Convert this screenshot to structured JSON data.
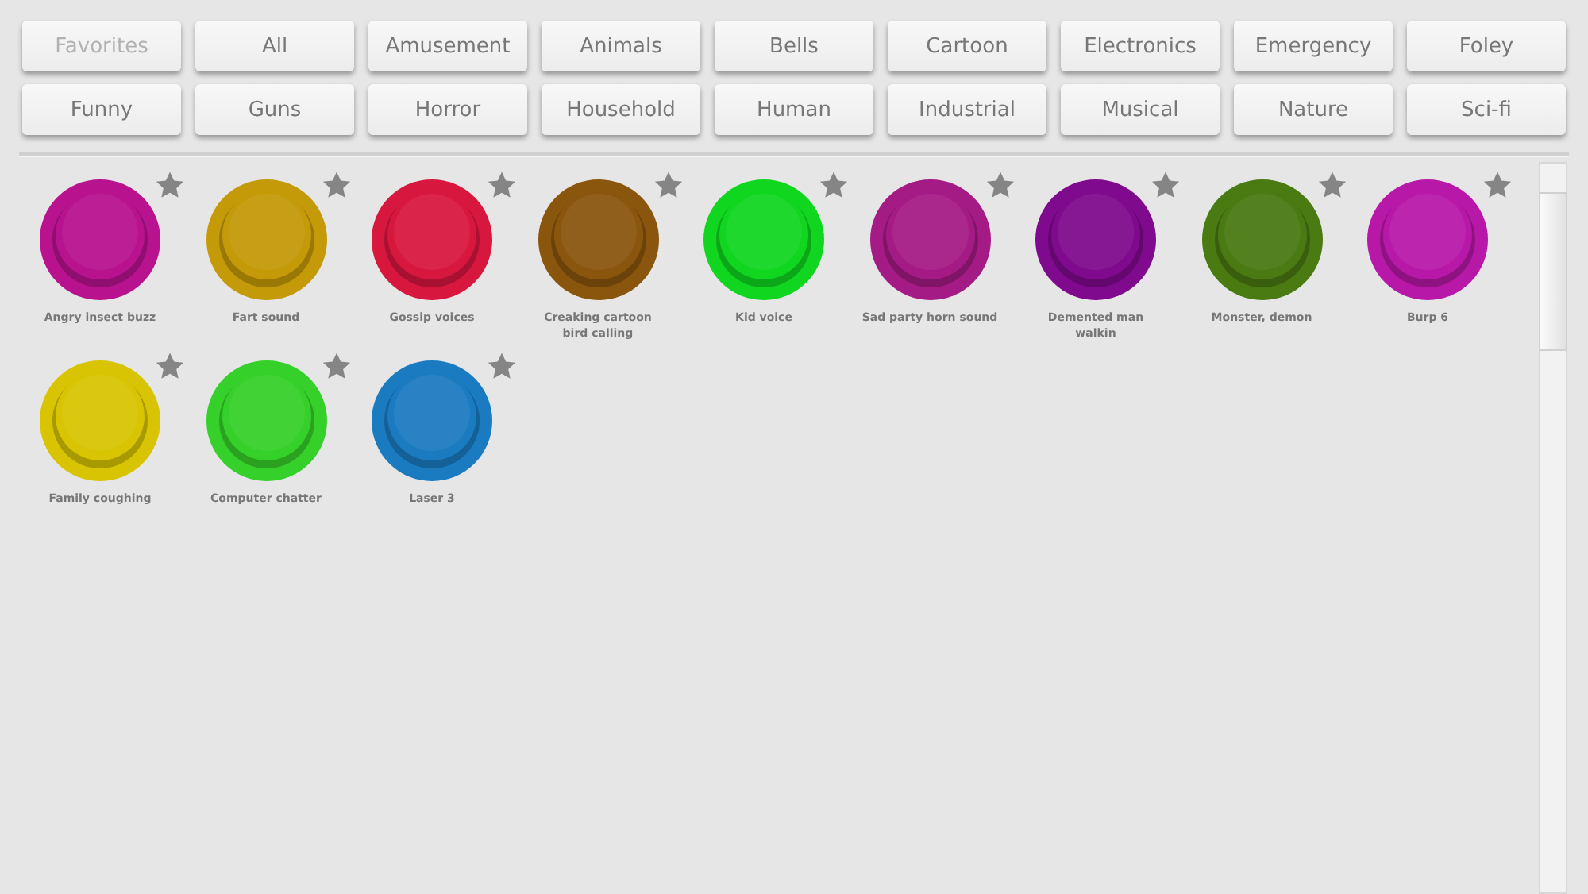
{
  "categories": [
    {
      "label": "Favorites",
      "disabled": true
    },
    {
      "label": "All",
      "disabled": false
    },
    {
      "label": "Amusement",
      "disabled": false
    },
    {
      "label": "Animals",
      "disabled": false
    },
    {
      "label": "Bells",
      "disabled": false
    },
    {
      "label": "Cartoon",
      "disabled": false
    },
    {
      "label": "Electronics",
      "disabled": false
    },
    {
      "label": "Emergency",
      "disabled": false
    },
    {
      "label": "Foley",
      "disabled": false
    },
    {
      "label": "Funny",
      "disabled": false
    },
    {
      "label": "Guns",
      "disabled": false
    },
    {
      "label": "Horror",
      "disabled": false
    },
    {
      "label": "Household",
      "disabled": false
    },
    {
      "label": "Human",
      "disabled": false
    },
    {
      "label": "Industrial",
      "disabled": false
    },
    {
      "label": "Musical",
      "disabled": false
    },
    {
      "label": "Nature",
      "disabled": false
    },
    {
      "label": "Sci-fi",
      "disabled": false
    }
  ],
  "sounds": [
    {
      "name": "Angry insect buzz",
      "color": "#b8128f"
    },
    {
      "name": "Fart sound",
      "color": "#c49a08"
    },
    {
      "name": "Gossip voices",
      "color": "#d8173f"
    },
    {
      "name": "Creaking cartoon bird calling",
      "color": "#8a560d"
    },
    {
      "name": "Kid voice",
      "color": "#10d620"
    },
    {
      "name": "Sad party horn sound",
      "color": "#a51b85"
    },
    {
      "name": "Demented man walkin",
      "color": "#800a8e"
    },
    {
      "name": "Monster, demon",
      "color": "#4a7a12"
    },
    {
      "name": "Burp 6",
      "color": "#b818a8"
    },
    {
      "name": "Family coughing",
      "color": "#d8c402"
    },
    {
      "name": "Computer chatter",
      "color": "#36d02a"
    },
    {
      "name": "Laser 3",
      "color": "#1b7bc0"
    }
  ]
}
